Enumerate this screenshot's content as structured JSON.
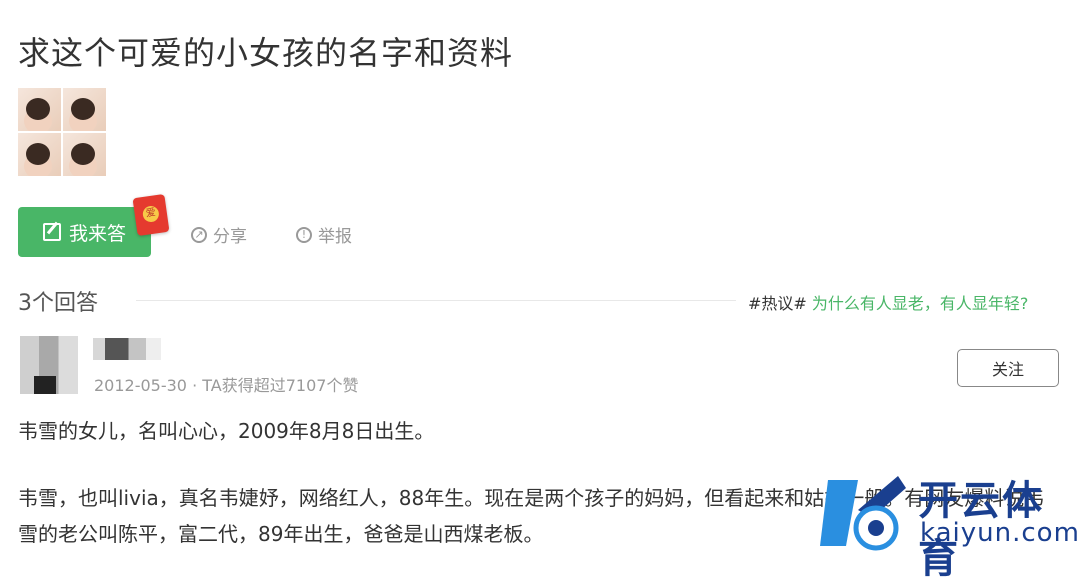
{
  "question": {
    "title": "求这个可爱的小女孩的名字和资料"
  },
  "actions": {
    "answer_label": "我来答",
    "redpack_icon": "red-envelope-icon",
    "redpack_char": "爱",
    "share_label": "分享",
    "report_label": "举报"
  },
  "answers_header": {
    "count_label": "3个回答",
    "topic_tag": "#热议#",
    "topic_question": "为什么有人显老，有人显年轻?"
  },
  "answer": {
    "meta": "2012-05-30 · TA获得超过7107个赞",
    "follow_label": "关注",
    "paragraphs": [
      "韦雪的女儿，名叫心心，2009年8月8日出生。",
      "韦雪，也叫livia，真名韦婕妤，网络红人，88年生。现在是两个孩子的妈妈，但看起来和姑娘一般。有网友爆料说韦雪的老公叫陈平，富二代，89年出生，爸爸是山西煤老板。"
    ]
  },
  "watermark": {
    "brand_cn": "开云体育",
    "brand_en": "kaiyun.com"
  },
  "colors": {
    "accent_green": "#49b667",
    "brand_blue": "#1a3f8f"
  }
}
